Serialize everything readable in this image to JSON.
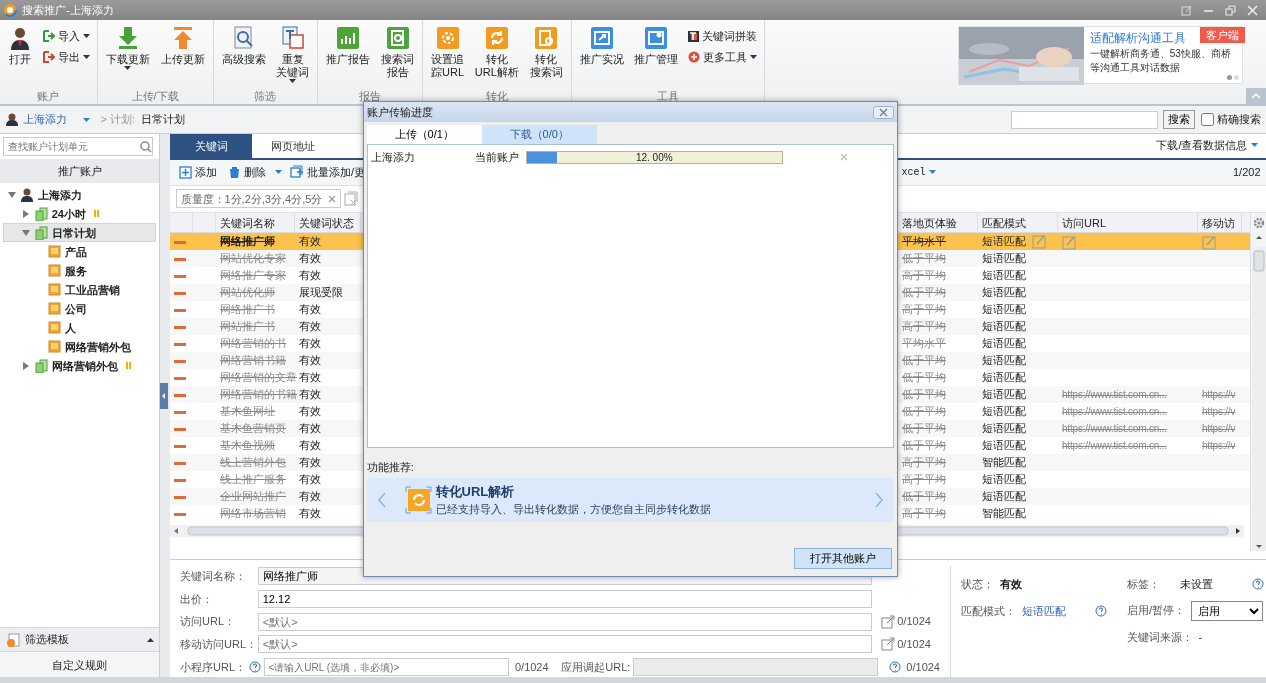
{
  "window": {
    "title": "搜索推广-上海添力"
  },
  "ribbon": {
    "groups": [
      {
        "label": "账户",
        "buttons": [
          {
            "kind": "large",
            "lines": [
              "打开"
            ]
          },
          {
            "kind": "small",
            "lines": [
              "导入"
            ],
            "dropdown": true
          },
          {
            "kind": "small",
            "lines": [
              "导出"
            ],
            "dropdown": true
          }
        ]
      },
      {
        "label": "上传/下载",
        "buttons": [
          {
            "kind": "large",
            "lines": [
              "下载更新"
            ],
            "dropdown": true
          },
          {
            "kind": "large",
            "lines": [
              "上传更新"
            ]
          }
        ]
      },
      {
        "label": "筛选",
        "buttons": [
          {
            "kind": "large",
            "lines": [
              "高级搜索"
            ]
          },
          {
            "kind": "large",
            "lines": [
              "重复",
              "关键词"
            ],
            "dropdown": true
          }
        ]
      },
      {
        "label": "报告",
        "buttons": [
          {
            "kind": "large",
            "lines": [
              "推广报告"
            ]
          },
          {
            "kind": "large",
            "lines": [
              "搜索词",
              "报告"
            ]
          }
        ]
      },
      {
        "label": "转化",
        "buttons": [
          {
            "kind": "large",
            "lines": [
              "设置追",
              "踪URL"
            ]
          },
          {
            "kind": "large",
            "lines": [
              "转化",
              "URL解析"
            ]
          },
          {
            "kind": "large",
            "lines": [
              "转化",
              "搜索词"
            ]
          }
        ]
      },
      {
        "label": "工具",
        "buttons": [
          {
            "kind": "large",
            "lines": [
              "推广实况"
            ]
          },
          {
            "kind": "large",
            "lines": [
              "推广管理"
            ]
          },
          {
            "kind": "small",
            "lines": [
              "关键词拼装"
            ]
          },
          {
            "kind": "small",
            "lines": [
              "更多工具"
            ],
            "dropdown": true
          }
        ]
      }
    ]
  },
  "promo": {
    "title": "适配解析沟通工具",
    "badge": "客户端",
    "description": "一键解析商务通、53快服、商桥等沟通工具对话数据",
    "pages": [
      {
        "selected": true
      },
      {
        "selected": false
      }
    ]
  },
  "breadcrumb": {
    "account": "上海添力",
    "separator": "> 计划:",
    "plan": "日常计划"
  },
  "search": {
    "button": "搜索",
    "exact": {
      "label": "精确搜索",
      "checked": false
    }
  },
  "sidebar": {
    "search_placeholder": "查找账户计划单元",
    "header": "推广账户",
    "tree": [
      {
        "label": "上海添力",
        "expanded": true,
        "selected": false,
        "children": [
          {
            "label": "24小时",
            "expanded": false,
            "selected": false,
            "paused": true
          },
          {
            "label": "日常计划",
            "expanded": true,
            "selected": true,
            "children": [
              {
                "label": "产品",
                "selected": false
              },
              {
                "label": "服务",
                "selected": false
              },
              {
                "label": "工业品营销",
                "selected": false
              },
              {
                "label": "公司",
                "selected": false
              },
              {
                "label": "人",
                "selected": false
              },
              {
                "label": "网络营销外包",
                "selected": false
              }
            ]
          },
          {
            "label": "网络营销外包",
            "expanded": false,
            "selected": false,
            "paused": true
          }
        ]
      }
    ],
    "template": {
      "label": "筛选模板",
      "expanded": false
    },
    "rules": "自定义规则"
  },
  "tabs": [
    {
      "label": "关键词",
      "selected": true
    },
    {
      "label": "网页地址",
      "selected": false
    }
  ],
  "data_menu": "下载/查看数据信息",
  "toolbar": {
    "add": "添加",
    "delete": "删除",
    "batch": "批量添加/更",
    "export": "xcel",
    "page": "1/202"
  },
  "filter": {
    "label": "质量度：1分,2分,3分,4分,5分"
  },
  "table": {
    "columns": [
      "关键词名称",
      "关键词状态",
      "落地页体验",
      "匹配模式",
      "访问URL",
      "移动访"
    ],
    "rows": [
      {
        "name": "网络推广师",
        "status": "有效",
        "landing": "平均水平",
        "match": "短语匹配",
        "selected": true,
        "paused": true
      },
      {
        "name": "网站优化专家",
        "status": "有效",
        "landing": "低于平均",
        "match": "短语匹配",
        "selected": false,
        "paused": true
      },
      {
        "name": "网络推广专家",
        "status": "有效",
        "landing": "高于平均",
        "match": "短语匹配",
        "selected": false,
        "paused": true
      },
      {
        "name": "网站优化师",
        "status": "展现受限",
        "landing": "低于平均",
        "match": "短语匹配",
        "selected": false,
        "paused": true
      },
      {
        "name": "网络推广书",
        "status": "有效",
        "landing": "高于平均",
        "match": "短语匹配",
        "selected": false,
        "paused": true
      },
      {
        "name": "网站推广书",
        "status": "有效",
        "landing": "高于平均",
        "match": "短语匹配",
        "selected": false,
        "paused": true
      },
      {
        "name": "网络营销的书",
        "status": "有效",
        "landing": "平均水平",
        "match": "短语匹配",
        "selected": false,
        "paused": true
      },
      {
        "name": "网络营销书籍",
        "status": "有效",
        "landing": "低于平均",
        "match": "短语匹配",
        "selected": false,
        "paused": true
      },
      {
        "name": "网络营销的文章",
        "status": "有效",
        "landing": "低于平均",
        "match": "短语匹配",
        "selected": false,
        "paused": true
      },
      {
        "name": "网络营销的书籍",
        "status": "有效",
        "landing": "低于平均",
        "match": "短语匹配",
        "url": "https://www.tist.com.cn...",
        "mobile_url": "https://v",
        "selected": false,
        "paused": true
      },
      {
        "name": "基木鱼网址",
        "status": "有效",
        "landing": "低于平均",
        "match": "短语匹配",
        "url": "https://www.tist.com.cn...",
        "mobile_url": "https://v",
        "selected": false,
        "paused": true
      },
      {
        "name": "基木鱼营销页",
        "status": "有效",
        "landing": "低于平均",
        "match": "短语匹配",
        "url": "https://www.tist.com.cn...",
        "mobile_url": "https://v",
        "selected": false,
        "paused": true
      },
      {
        "name": "基木鱼视频",
        "status": "有效",
        "landing": "低于平均",
        "match": "短语匹配",
        "url": "https://www.tist.com.cn...",
        "mobile_url": "https://v",
        "selected": false,
        "paused": true
      },
      {
        "name": "线上营销外包",
        "status": "有效",
        "landing": "高于平均",
        "match": "智能匹配",
        "selected": false,
        "paused": true
      },
      {
        "name": "线上推广服务",
        "status": "有效",
        "landing": "高于平均",
        "match": "短语匹配",
        "selected": false,
        "paused": true
      },
      {
        "name": "企业网站推广",
        "status": "有效",
        "landing": "低于平均",
        "match": "短语匹配",
        "selected": false,
        "paused": true
      },
      {
        "name": "网络市场营销",
        "status": "有效",
        "landing": "高于平均",
        "match": "智能匹配",
        "selected": false,
        "paused": true
      }
    ]
  },
  "details": {
    "fields": [
      {
        "label": "关键词名称：",
        "value": "网络推广师"
      },
      {
        "label": "出价：",
        "value": "12.12"
      },
      {
        "label": "访问URL：",
        "placeholder": "<默认>",
        "count": "0/1024"
      },
      {
        "label": "移动访问URL：",
        "placeholder": "<默认>",
        "count": "0/1024"
      }
    ],
    "miniapp": {
      "label": "小程序URL：",
      "placeholder": "<请输入URL (选填，非必填)>",
      "count": "0/1024",
      "app_label": "应用调起URL:",
      "app_count": "0/1024",
      "app_disabled": true
    },
    "status": {
      "label": "状态：",
      "value": "有效"
    },
    "match": {
      "label": "匹配模式：",
      "value": "短语匹配"
    },
    "tag": {
      "label": "标签：",
      "value": "未设置"
    },
    "toggle": {
      "label": "启用/暂停：",
      "value": "启用"
    },
    "source": {
      "label": "关键词来源：",
      "value": "-"
    }
  },
  "dialog": {
    "title": "账户传输进度",
    "tabs": [
      {
        "label": "上传（0/1）",
        "selected": true
      },
      {
        "label": "下载（0/0）",
        "selected": false
      }
    ],
    "transfers": [
      {
        "account": "上海添力",
        "note": "当前账户",
        "level": 0.12,
        "reading": "12. 00%"
      }
    ],
    "recommend_label": "功能推荐:",
    "feature": {
      "title": "转化URL解析",
      "description": "已经支持导入、导出转化数据，方便您自主同步转化数据"
    },
    "button": "打开其他账户"
  }
}
